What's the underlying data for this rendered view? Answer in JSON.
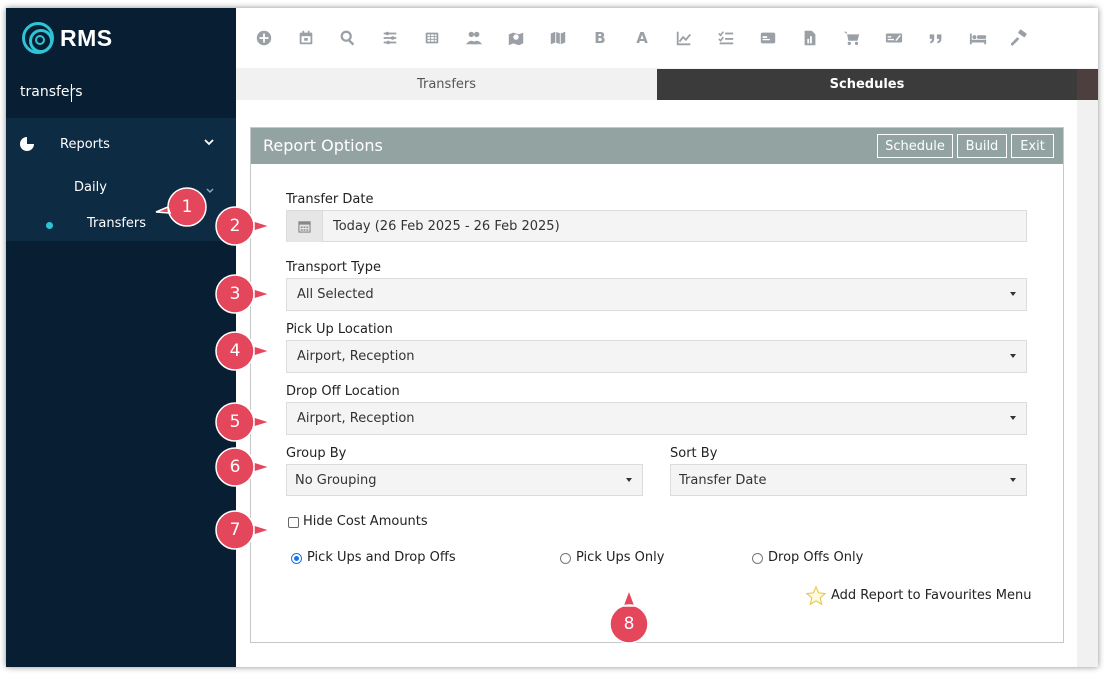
{
  "app": {
    "logo_text": "RMS"
  },
  "sidebar": {
    "search_value": "transfers",
    "menu": {
      "reports_label": "Reports",
      "daily_label": "Daily",
      "transfers_label": "Transfers"
    }
  },
  "toolbar": {
    "icons": [
      "plus-circle-icon",
      "calendar-icon",
      "search-icon",
      "sliders-icon",
      "grid-icon",
      "people-icon",
      "map-pin-icon",
      "map-icon",
      "bold-icon",
      "font-icon",
      "line-chart-icon",
      "checklist-icon",
      "card-icon",
      "report-icon",
      "cart-icon",
      "voucher-icon",
      "quote-icon",
      "bed-icon",
      "hammer-icon"
    ],
    "bold_glyph": "B",
    "font_glyph": "A"
  },
  "tabs": [
    {
      "label": "Transfers",
      "active": false
    },
    {
      "label": "Schedules",
      "active": true
    }
  ],
  "report": {
    "title": "Report Options",
    "buttons": {
      "schedule": "Schedule",
      "build": "Build",
      "exit": "Exit"
    },
    "transfer_date": {
      "label": "Transfer Date",
      "value": "Today (26 Feb 2025 - 26 Feb 2025)"
    },
    "transport_type": {
      "label": "Transport Type",
      "value": "All Selected"
    },
    "pick_up_location": {
      "label": "Pick Up Location",
      "value": "Airport, Reception"
    },
    "drop_off_location": {
      "label": "Drop Off Location",
      "value": "Airport, Reception"
    },
    "group_by": {
      "label": "Group By",
      "value": "No Grouping"
    },
    "sort_by": {
      "label": "Sort By",
      "value": "Transfer Date"
    },
    "hide_cost": {
      "label": "Hide Cost Amounts",
      "checked": false
    },
    "radio_options": [
      {
        "label": "Pick Ups and Drop Offs",
        "selected": true
      },
      {
        "label": "Pick Ups Only",
        "selected": false
      },
      {
        "label": "Drop Offs Only",
        "selected": false
      }
    ],
    "favourites_label": "Add Report to Favourites Menu"
  },
  "callouts": [
    "1",
    "2",
    "3",
    "4",
    "5",
    "6",
    "7",
    "8"
  ],
  "colors": {
    "sidebar_bg": "#071e33",
    "accent": "#2ec4d6",
    "callout": "#e4475b",
    "panel_header": "#93a3a1"
  }
}
